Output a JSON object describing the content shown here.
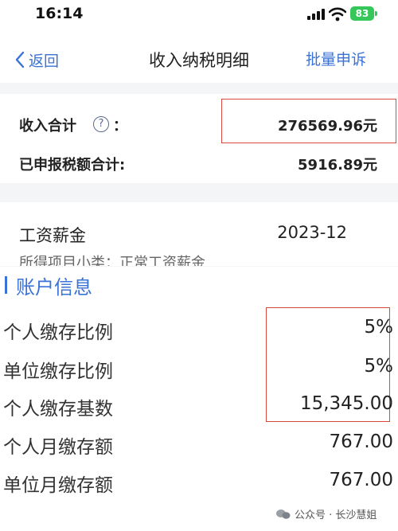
{
  "status_bar": {
    "time": "16:14",
    "battery": "83"
  },
  "nav": {
    "back_label": "返回",
    "title": "收入纳税明细",
    "action": "批量申诉"
  },
  "summary": {
    "income_label": "收入合计",
    "help_glyph": "?",
    "colon": "：",
    "income_value": "276569.96元",
    "tax_label": "已申报税额合计:",
    "tax_value": "5916.89元"
  },
  "record": {
    "type": "工资薪金",
    "period": "2023-12",
    "subtype": "所得项目小类：正常工资薪金"
  },
  "account": {
    "title": "账户信息",
    "rows": [
      {
        "label": "个人缴存比例",
        "value": "5%"
      },
      {
        "label": "单位缴存比例",
        "value": "5%"
      },
      {
        "label": "个人缴存基数",
        "value": "15,345.00"
      },
      {
        "label": "个人月缴存额",
        "value": "767.00"
      },
      {
        "label": "单位月缴存额",
        "value": "767.00"
      }
    ]
  },
  "watermark": "公众号 · 长沙慧姐",
  "colors": {
    "accent": "#3a72d6",
    "highlight": "#d94a3c",
    "battery": "#35c759"
  }
}
